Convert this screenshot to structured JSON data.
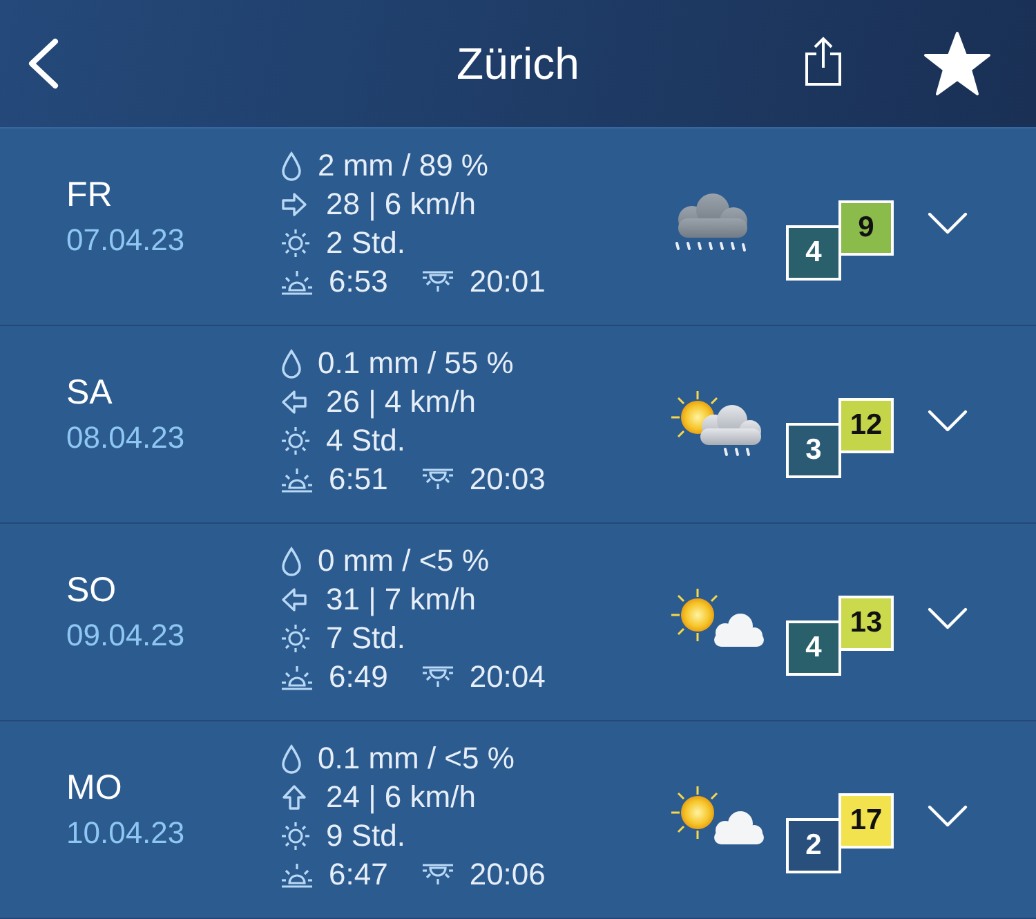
{
  "header": {
    "title": "Zürich",
    "favorite": true
  },
  "days": [
    {
      "day": "FR",
      "date": "07.04.23",
      "precipitation": "2 mm / 89 %",
      "wind": {
        "kind": "right",
        "text": "28 | 6 km/h"
      },
      "sunshine": "2 Std.",
      "sunrise": "6:53",
      "sunset": "20:01",
      "weather": {
        "kind": "rain"
      },
      "min_temp": {
        "value": "4",
        "color": "#29606b"
      },
      "max_temp": {
        "value": "9",
        "color": "#8bbb4b"
      },
      "expanded": false
    },
    {
      "day": "SA",
      "date": "08.04.23",
      "precipitation": "0.1 mm / 55 %",
      "wind": {
        "kind": "left",
        "text": "26 | 4 km/h"
      },
      "sunshine": "4 Std.",
      "sunrise": "6:51",
      "sunset": "20:03",
      "weather": {
        "kind": "showers"
      },
      "min_temp": {
        "value": "3",
        "color": "#2b5a75"
      },
      "max_temp": {
        "value": "12",
        "color": "#c4d54a"
      },
      "expanded": false
    },
    {
      "day": "SO",
      "date": "09.04.23",
      "precipitation": "0 mm / <5 %",
      "wind": {
        "kind": "left",
        "text": "31 | 7 km/h"
      },
      "sunshine": "7 Std.",
      "sunrise": "6:49",
      "sunset": "20:04",
      "weather": {
        "kind": "cloudy"
      },
      "min_temp": {
        "value": "4",
        "color": "#29606b"
      },
      "max_temp": {
        "value": "13",
        "color": "#cbd94c"
      },
      "expanded": false
    },
    {
      "day": "MO",
      "date": "10.04.23",
      "precipitation": "0.1 mm / <5 %",
      "wind": {
        "kind": "up",
        "text": "24 | 6 km/h"
      },
      "sunshine": "9 Std.",
      "sunrise": "6:47",
      "sunset": "20:06",
      "weather": {
        "kind": "cloudy"
      },
      "min_temp": {
        "value": "2",
        "color": "#29507d"
      },
      "max_temp": {
        "value": "17",
        "color": "#f2e34e"
      },
      "expanded": false
    }
  ]
}
